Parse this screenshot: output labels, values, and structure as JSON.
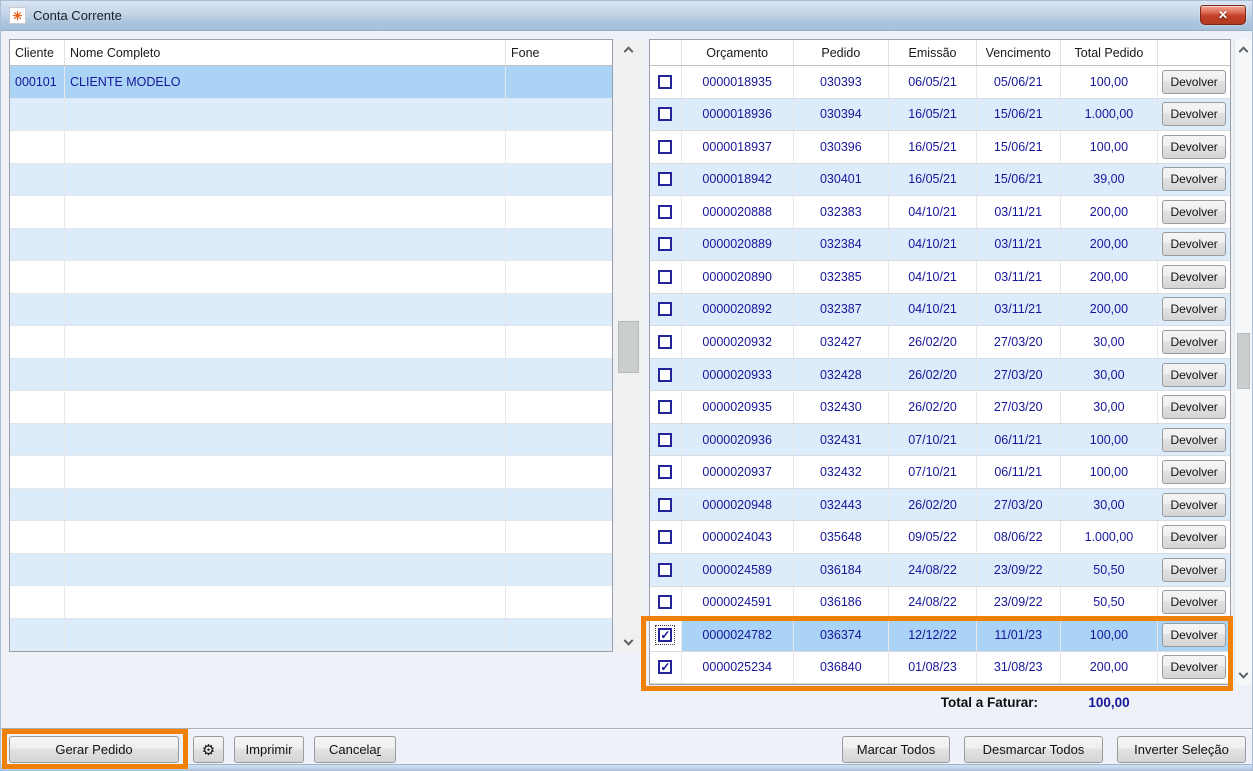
{
  "window": {
    "title": "Conta Corrente"
  },
  "icons": {
    "app_glyph": "✳",
    "close": "✕",
    "gear": "⚙",
    "check": "✓"
  },
  "clients_table": {
    "headers": {
      "cliente": "Cliente",
      "nome": "Nome Completo",
      "fone": "Fone"
    },
    "rows": [
      {
        "cliente": "000101",
        "nome": "CLIENTE MODELO",
        "fone": "",
        "selected": true
      }
    ],
    "visible_empty_rows": 17
  },
  "orders_table": {
    "headers": {
      "orcamento": "Orçamento",
      "pedido": "Pedido",
      "emissao": "Emissão",
      "vencimento": "Vencimento",
      "total": "Total Pedido"
    },
    "action_label": "Devolver",
    "rows": [
      {
        "checked": false,
        "selected": false,
        "orcamento": "0000018935",
        "pedido": "030393",
        "emissao": "06/05/21",
        "vencimento": "05/06/21",
        "total": "100,00"
      },
      {
        "checked": false,
        "selected": false,
        "orcamento": "0000018936",
        "pedido": "030394",
        "emissao": "16/05/21",
        "vencimento": "15/06/21",
        "total": "1.000,00"
      },
      {
        "checked": false,
        "selected": false,
        "orcamento": "0000018937",
        "pedido": "030396",
        "emissao": "16/05/21",
        "vencimento": "15/06/21",
        "total": "100,00"
      },
      {
        "checked": false,
        "selected": false,
        "orcamento": "0000018942",
        "pedido": "030401",
        "emissao": "16/05/21",
        "vencimento": "15/06/21",
        "total": "39,00"
      },
      {
        "checked": false,
        "selected": false,
        "orcamento": "0000020888",
        "pedido": "032383",
        "emissao": "04/10/21",
        "vencimento": "03/11/21",
        "total": "200,00"
      },
      {
        "checked": false,
        "selected": false,
        "orcamento": "0000020889",
        "pedido": "032384",
        "emissao": "04/10/21",
        "vencimento": "03/11/21",
        "total": "200,00"
      },
      {
        "checked": false,
        "selected": false,
        "orcamento": "0000020890",
        "pedido": "032385",
        "emissao": "04/10/21",
        "vencimento": "03/11/21",
        "total": "200,00"
      },
      {
        "checked": false,
        "selected": false,
        "orcamento": "0000020892",
        "pedido": "032387",
        "emissao": "04/10/21",
        "vencimento": "03/11/21",
        "total": "200,00"
      },
      {
        "checked": false,
        "selected": false,
        "orcamento": "0000020932",
        "pedido": "032427",
        "emissao": "26/02/20",
        "vencimento": "27/03/20",
        "total": "30,00"
      },
      {
        "checked": false,
        "selected": false,
        "orcamento": "0000020933",
        "pedido": "032428",
        "emissao": "26/02/20",
        "vencimento": "27/03/20",
        "total": "30,00"
      },
      {
        "checked": false,
        "selected": false,
        "orcamento": "0000020935",
        "pedido": "032430",
        "emissao": "26/02/20",
        "vencimento": "27/03/20",
        "total": "30,00"
      },
      {
        "checked": false,
        "selected": false,
        "orcamento": "0000020936",
        "pedido": "032431",
        "emissao": "07/10/21",
        "vencimento": "06/11/21",
        "total": "100,00"
      },
      {
        "checked": false,
        "selected": false,
        "orcamento": "0000020937",
        "pedido": "032432",
        "emissao": "07/10/21",
        "vencimento": "06/11/21",
        "total": "100,00"
      },
      {
        "checked": false,
        "selected": false,
        "orcamento": "0000020948",
        "pedido": "032443",
        "emissao": "26/02/20",
        "vencimento": "27/03/20",
        "total": "30,00"
      },
      {
        "checked": false,
        "selected": false,
        "orcamento": "0000024043",
        "pedido": "035648",
        "emissao": "09/05/22",
        "vencimento": "08/06/22",
        "total": "1.000,00"
      },
      {
        "checked": false,
        "selected": false,
        "orcamento": "0000024589",
        "pedido": "036184",
        "emissao": "24/08/22",
        "vencimento": "23/09/22",
        "total": "50,50"
      },
      {
        "checked": false,
        "selected": false,
        "orcamento": "0000024591",
        "pedido": "036186",
        "emissao": "24/08/22",
        "vencimento": "23/09/22",
        "total": "50,50"
      },
      {
        "checked": true,
        "selected": true,
        "orcamento": "0000024782",
        "pedido": "036374",
        "emissao": "12/12/22",
        "vencimento": "11/01/23",
        "total": "100,00"
      },
      {
        "checked": true,
        "selected": false,
        "orcamento": "0000025234",
        "pedido": "036840",
        "emissao": "01/08/23",
        "vencimento": "31/08/23",
        "total": "200,00"
      }
    ]
  },
  "summary": {
    "label": "Total a Faturar:",
    "value": "100,00"
  },
  "footer": {
    "gerar_pedido": "Gerar Pedido",
    "imprimir": "Imprimir",
    "cancelar": {
      "text": "Cancela",
      "mnemonic": "r"
    },
    "marcar_todos": "Marcar Todos",
    "desmarcar_todos": "Desmarcar Todos",
    "inverter_selecao": "Inverter Seleção"
  },
  "colors": {
    "annotation_orange": "#ef8109",
    "selection_blue": "#abd3f6",
    "stripe_blue": "#ddecfb",
    "data_text_navy": "#16169a",
    "close_button_red": "#c23f26"
  }
}
